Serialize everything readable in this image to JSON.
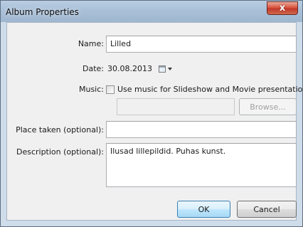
{
  "dialog": {
    "title": "Album Properties",
    "close_label": "x"
  },
  "form": {
    "name_label": "Name:",
    "name_value": "Lilled",
    "date_label": "Date:",
    "date_value": "30.08.2013",
    "music_label": "Music:",
    "music_checkbox_label": "Use music for Slideshow and Movie presentation:",
    "music_checked": false,
    "music_file_value": "",
    "browse_label": "Browse...",
    "place_label": "Place taken (optional):",
    "place_value": "",
    "description_label": "Description (optional):",
    "description_value": "Ilusad lillepildid. Puhas kunst."
  },
  "buttons": {
    "ok_label": "OK",
    "cancel_label": "Cancel"
  },
  "icons": [
    "close-icon",
    "calendar-icon",
    "chevron-down-icon",
    "checkbox-icon"
  ],
  "colors": {
    "titlebar": "#a9c0d8",
    "close_button": "#c1392a",
    "default_button": "#3c7fb1",
    "client_background": "#f0f0f0"
  }
}
